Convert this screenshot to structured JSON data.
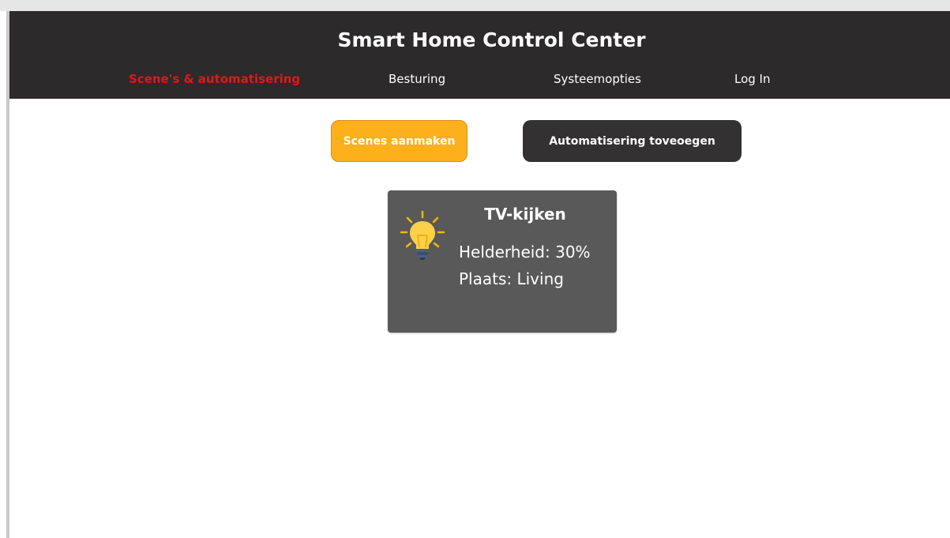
{
  "app": {
    "title": "Smart Home Control Center"
  },
  "nav": {
    "items": [
      {
        "label": "Scene's & automatisering",
        "active": true
      },
      {
        "label": "Besturing",
        "active": false
      },
      {
        "label": "Systeemopties",
        "active": false
      },
      {
        "label": "Log In",
        "active": false
      }
    ]
  },
  "actions": {
    "create_scene_label": "Scenes aanmaken",
    "add_automation_label": "Automatisering toveoegen"
  },
  "scenes": [
    {
      "icon": "light-bulb-icon",
      "name": "TV-kijken",
      "brightness": "Helderheid: 30%",
      "location": "Plaats: Living"
    }
  ],
  "colors": {
    "header_bg": "#2c2a2b",
    "active_nav": "#e0181b",
    "primary_button": "#fdb01b",
    "secondary_button": "#333132",
    "card_bg": "#595959"
  }
}
